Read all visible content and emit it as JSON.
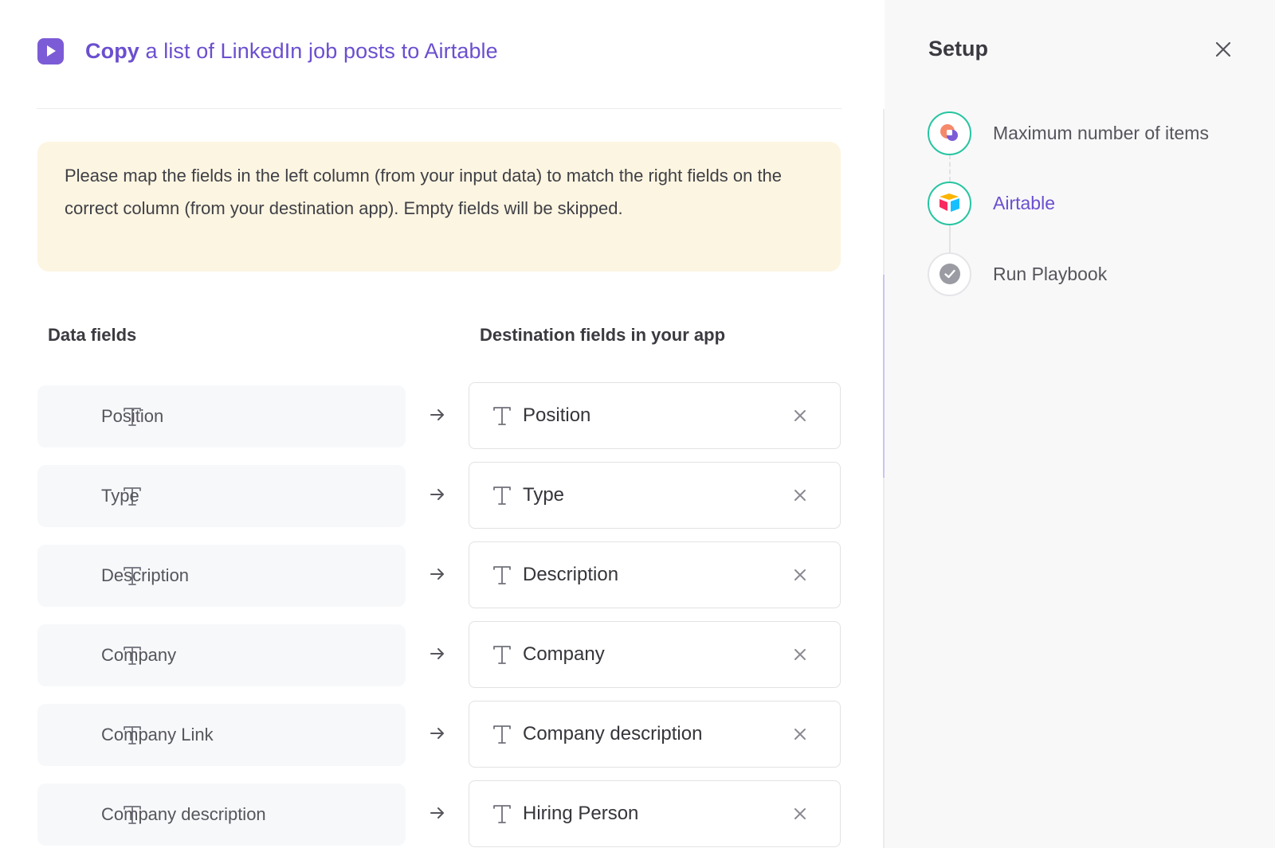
{
  "header": {
    "title_bold": "Copy",
    "title_rest": " a list of LinkedIn job posts to Airtable",
    "icon": "play-icon"
  },
  "notice": {
    "text": "Please map the fields in the left column (from your input data) to match the right fields on the correct column (from your destination app). Empty fields will be skipped."
  },
  "columns": {
    "left_header": "Data fields",
    "right_header": "Destination fields in your app"
  },
  "mappings": [
    {
      "source": "Position",
      "destination": "Position"
    },
    {
      "source": "Type",
      "destination": "Type"
    },
    {
      "source": "Description",
      "destination": "Description"
    },
    {
      "source": "Company",
      "destination": "Company"
    },
    {
      "source": "Company Link",
      "destination": "Company description"
    },
    {
      "source": "Company description",
      "destination": "Hiring Person"
    }
  ],
  "setup": {
    "title": "Setup",
    "steps": [
      {
        "label": "Maximum number of items",
        "icon": "items-app-icon",
        "state": "done"
      },
      {
        "label": "Airtable",
        "icon": "airtable-icon",
        "state": "active"
      },
      {
        "label": "Run Playbook",
        "icon": "check-icon",
        "state": "pending"
      }
    ]
  },
  "colors": {
    "accent": "#6b4fcf",
    "step_done": "#25c5a0",
    "notice_bg": "#fcf5e1"
  }
}
